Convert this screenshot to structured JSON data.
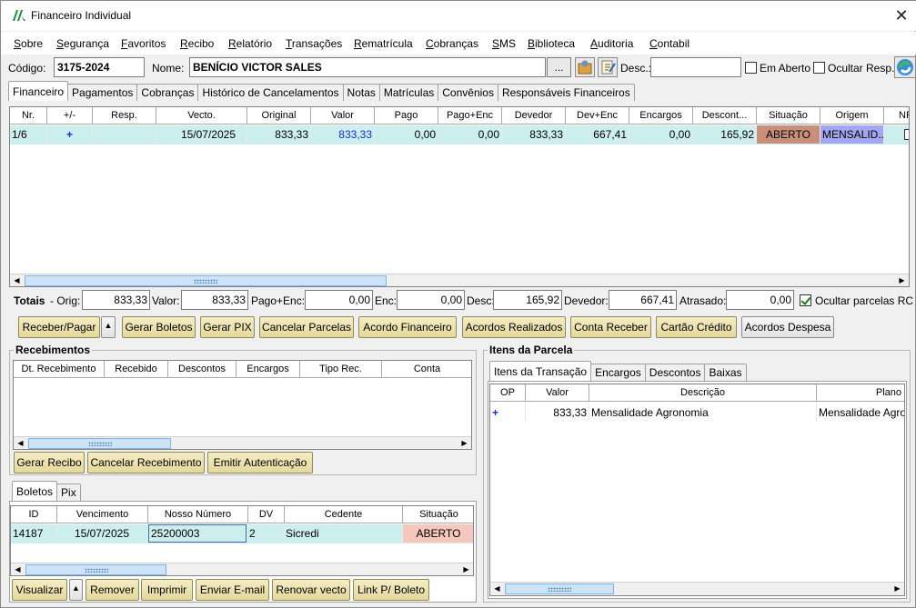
{
  "window": {
    "title": "Financeiro Individual",
    "close": "✕"
  },
  "menu": [
    "Sobre",
    "Segurança",
    "Favoritos",
    "Recibo",
    "Relatório",
    "Transações",
    "Rematrícula",
    "Cobranças",
    "SMS",
    "Biblioteca",
    "Auditoria",
    "Contabil"
  ],
  "header": {
    "codigo_label": "Código:",
    "codigo_value": "3175-2024",
    "nome_label": "Nome:",
    "nome_value": "BENÍCIO VICTOR SALES",
    "ellipsis": "...",
    "desc_label": "Desc.:",
    "desc_value": "",
    "em_aberto_label": "Em Aberto",
    "ocultar_resp_label": "Ocultar Resp."
  },
  "main_tabs": [
    "Financeiro",
    "Pagamentos",
    "Cobranças",
    "Histórico de Cancelamentos",
    "Notas",
    "Matrículas",
    "Convênios",
    "Responsáveis Financeiros"
  ],
  "parcelas": {
    "columns": [
      "Nr.",
      "+/-",
      "Resp.",
      "Vecto.",
      "Original",
      "Valor",
      "Pago",
      "Pago+Enc",
      "Devedor",
      "Dev+Enc",
      "Encargos",
      "Descont...",
      "Situação",
      "Origem",
      "NF"
    ],
    "row": {
      "nr": "1/6",
      "plus": "+",
      "resp": "",
      "vecto": "15/07/2025",
      "original": "833,33",
      "valor": "833,33",
      "pago": "0,00",
      "pago_enc": "0,00",
      "devedor": "833,33",
      "dev_enc": "667,41",
      "encargos": "0,00",
      "desconto": "165,92",
      "situacao": "ABERTO",
      "origem": "MENSALID..."
    }
  },
  "totais": {
    "label": "Totais",
    "orig_label": "- Orig:",
    "orig": "833,33",
    "valor_label": "Valor:",
    "valor": "833,33",
    "pago_enc_label": "Pago+Enc:",
    "pago_enc": "0,00",
    "enc_label": "Enc:",
    "enc": "0,00",
    "desc_label": "Desc:",
    "desc": "165,92",
    "devedor_label": "Devedor:",
    "devedor": "667,41",
    "atrasado_label": "Atrasado:",
    "atrasado": "0,00",
    "ocultar_label": "Ocultar parcelas RC"
  },
  "actions": [
    "Receber/Pagar",
    "Gerar Boletos",
    "Gerar PIX",
    "Cancelar Parcelas",
    "Acordo Financeiro",
    "Acordos Realizados",
    "Conta Receber",
    "Cartão Crédito",
    "Acordos Despesa"
  ],
  "recebimentos": {
    "title": "Recebimentos",
    "columns": [
      "Dt. Recebimento",
      "Recebido",
      "Descontos",
      "Encargos",
      "Tipo Rec.",
      "Conta"
    ],
    "buttons": [
      "Gerar Recibo",
      "Cancelar Recebimento",
      "Emitir Autenticação"
    ]
  },
  "boletos": {
    "tabs": [
      "Boletos",
      "Pix"
    ],
    "columns": [
      "ID",
      "Vencimento",
      "Nosso Número",
      "DV",
      "Cedente",
      "Situação"
    ],
    "row": {
      "id": "14187",
      "vencimento": "15/07/2025",
      "nosso_numero": "25200003",
      "dv": "2",
      "cedente": "Sicredi",
      "situacao": "ABERTO"
    },
    "buttons": [
      "Visualizar",
      "Remover",
      "Imprimir",
      "Enviar E-mail",
      "Renovar vecto",
      "Link P/ Boleto"
    ]
  },
  "itens": {
    "title": "Itens da Parcela",
    "tabs": [
      "Itens da Transação",
      "Encargos",
      "Descontos",
      "Baixas"
    ],
    "columns": [
      "OP",
      "Valor",
      "Descrição",
      "Plano"
    ],
    "row": {
      "op": "+",
      "valor": "833,33",
      "descricao": "Mensalidade Agronomia",
      "plano": "Mensalidade Agro"
    }
  },
  "colors": {
    "aberto": "#c8907a",
    "origem": "#a3a6f0",
    "row_sel": "#cdeeee",
    "boleto_aberto": "#f6c8bd",
    "btn": "#ece1b0"
  }
}
